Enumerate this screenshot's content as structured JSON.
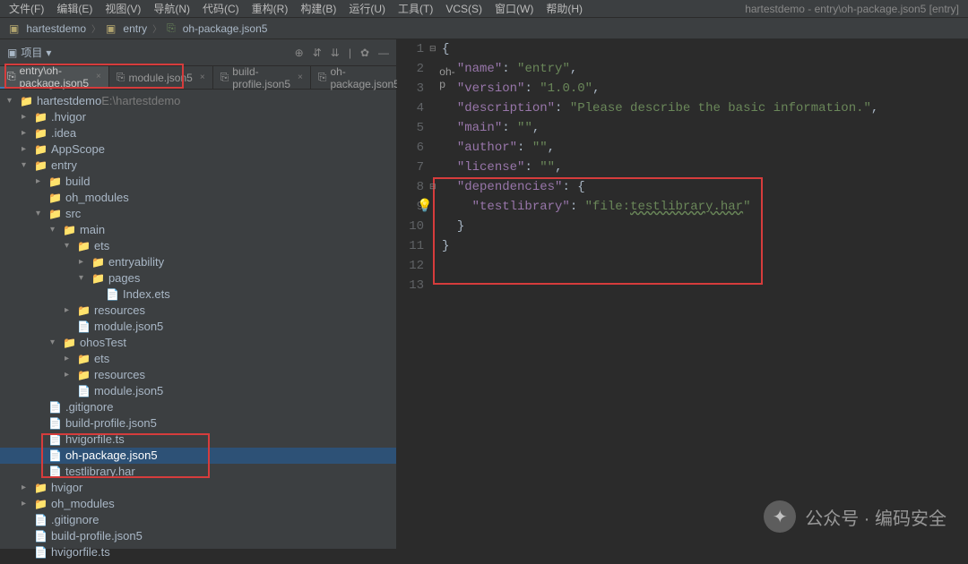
{
  "menubar": [
    "文件(F)",
    "编辑(E)",
    "视图(V)",
    "导航(N)",
    "代码(C)",
    "重构(R)",
    "构建(B)",
    "运行(U)",
    "工具(T)",
    "VCS(S)",
    "窗口(W)",
    "帮助(H)"
  ],
  "windowTitle": "hartestdemo - entry\\oh-package.json5 [entry]",
  "breadcrumb": {
    "root": "hartestdemo",
    "module": "entry",
    "file": "oh-package.json5"
  },
  "projectPanel": {
    "label": "项目",
    "rootName": "hartestdemo",
    "rootPath": "E:\\hartestdemo"
  },
  "tree": [
    {
      "d": 0,
      "c": "▾",
      "i": "📁",
      "cls": "folder-b",
      "t": "hartestdemo",
      "extra": "E:\\hartestdemo"
    },
    {
      "d": 1,
      "c": "▸",
      "i": "📁",
      "cls": "folder-y",
      "t": ".hvigor"
    },
    {
      "d": 1,
      "c": "▸",
      "i": "📁",
      "cls": "folder-y",
      "t": ".idea"
    },
    {
      "d": 1,
      "c": "▸",
      "i": "📁",
      "cls": "folder-y",
      "t": "AppScope"
    },
    {
      "d": 1,
      "c": "▾",
      "i": "📁",
      "cls": "folder-b",
      "t": "entry"
    },
    {
      "d": 2,
      "c": "▸",
      "i": "📁",
      "cls": "folder-o",
      "t": "build"
    },
    {
      "d": 2,
      "c": " ",
      "i": "📁",
      "cls": "folder-y",
      "t": "oh_modules"
    },
    {
      "d": 2,
      "c": "▾",
      "i": "📁",
      "cls": "folder-y",
      "t": "src"
    },
    {
      "d": 3,
      "c": "▾",
      "i": "📁",
      "cls": "folder-y",
      "t": "main"
    },
    {
      "d": 4,
      "c": "▾",
      "i": "📁",
      "cls": "folder-y",
      "t": "ets"
    },
    {
      "d": 5,
      "c": "▸",
      "i": "📁",
      "cls": "folder-y",
      "t": "entryability"
    },
    {
      "d": 5,
      "c": "▾",
      "i": "📁",
      "cls": "folder-y",
      "t": "pages"
    },
    {
      "d": 6,
      "c": " ",
      "i": "📄",
      "cls": "file-c",
      "t": "Index.ets"
    },
    {
      "d": 4,
      "c": "▸",
      "i": "📁",
      "cls": "folder-y",
      "t": "resources"
    },
    {
      "d": 4,
      "c": " ",
      "i": "📄",
      "cls": "file-g",
      "t": "module.json5"
    },
    {
      "d": 3,
      "c": "▾",
      "i": "📁",
      "cls": "folder-y",
      "t": "ohosTest"
    },
    {
      "d": 4,
      "c": "▸",
      "i": "📁",
      "cls": "folder-y",
      "t": "ets"
    },
    {
      "d": 4,
      "c": "▸",
      "i": "📁",
      "cls": "folder-y",
      "t": "resources"
    },
    {
      "d": 4,
      "c": " ",
      "i": "📄",
      "cls": "file-g",
      "t": "module.json5"
    },
    {
      "d": 2,
      "c": " ",
      "i": "📄",
      "cls": "file-c",
      "t": ".gitignore"
    },
    {
      "d": 2,
      "c": " ",
      "i": "📄",
      "cls": "file-g",
      "t": "build-profile.json5"
    },
    {
      "d": 2,
      "c": " ",
      "i": "📄",
      "cls": "file-ts",
      "t": "hvigorfile.ts"
    },
    {
      "d": 2,
      "c": " ",
      "i": "📄",
      "cls": "file-g",
      "t": "oh-package.json5",
      "sel": true
    },
    {
      "d": 2,
      "c": " ",
      "i": "📄",
      "cls": "file-c",
      "t": "testlibrary.har"
    },
    {
      "d": 1,
      "c": "▸",
      "i": "📁",
      "cls": "folder-y",
      "t": "hvigor"
    },
    {
      "d": 1,
      "c": "▸",
      "i": "📁",
      "cls": "folder-o",
      "t": "oh_modules"
    },
    {
      "d": 1,
      "c": " ",
      "i": "📄",
      "cls": "file-c",
      "t": ".gitignore"
    },
    {
      "d": 1,
      "c": " ",
      "i": "📄",
      "cls": "file-g",
      "t": "build-profile.json5"
    },
    {
      "d": 1,
      "c": " ",
      "i": "📄",
      "cls": "file-ts",
      "t": "hvigorfile.ts"
    }
  ],
  "tabs": [
    {
      "label": "entry\\oh-package.json5",
      "active": true
    },
    {
      "label": "module.json5"
    },
    {
      "label": "build-profile.json5"
    },
    {
      "label": "oh-package.json5"
    },
    {
      "label": "oh-p"
    }
  ],
  "code": {
    "lines": [
      1,
      2,
      3,
      4,
      5,
      6,
      7,
      8,
      9,
      10,
      11,
      12,
      13
    ],
    "content": {
      "name_key": "\"name\"",
      "name_val": "\"entry\"",
      "version_key": "\"version\"",
      "version_val": "\"1.0.0\"",
      "desc_key": "\"description\"",
      "desc_val": "\"Please describe the basic information.\"",
      "main_key": "\"main\"",
      "main_val": "\"\"",
      "author_key": "\"author\"",
      "author_val": "\"\"",
      "license_key": "\"license\"",
      "license_val": "\"\"",
      "deps_key": "\"dependencies\"",
      "testlib_key": "\"testlibrary\"",
      "testlib_pre": "\"file:",
      "testlib_link": "testlibrary.har",
      "testlib_post": "\""
    }
  },
  "watermark": "公众号 · 编码安全"
}
